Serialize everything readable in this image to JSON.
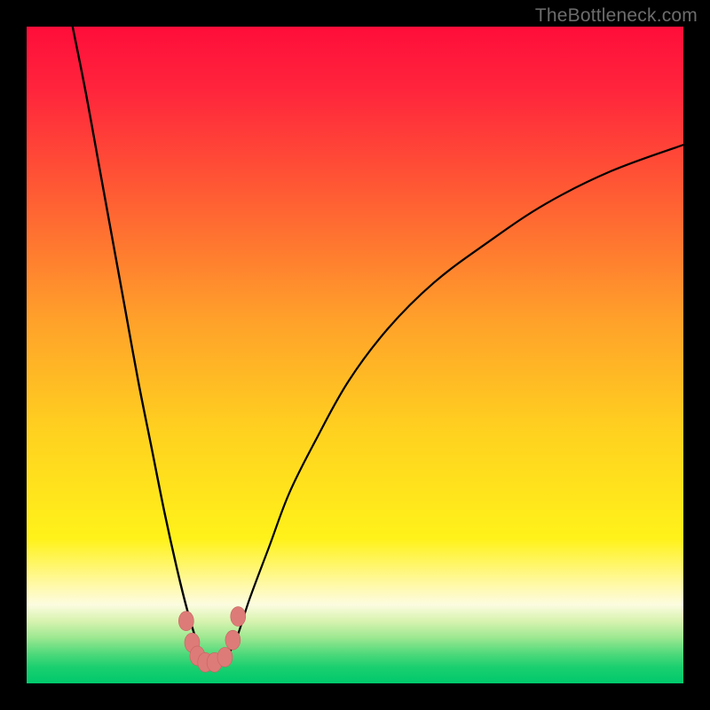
{
  "watermark": "TheBottleneck.com",
  "colors": {
    "frame_bg": "#000000",
    "gradient_stops": [
      {
        "pos": 0.0,
        "color": "#ff0d3a"
      },
      {
        "pos": 0.1,
        "color": "#ff263c"
      },
      {
        "pos": 0.25,
        "color": "#ff5a34"
      },
      {
        "pos": 0.45,
        "color": "#ffa22a"
      },
      {
        "pos": 0.62,
        "color": "#ffd21f"
      },
      {
        "pos": 0.78,
        "color": "#fff21a"
      },
      {
        "pos": 0.82,
        "color": "#fff66a"
      },
      {
        "pos": 0.85,
        "color": "#fff9a8"
      },
      {
        "pos": 0.88,
        "color": "#fcfce0"
      },
      {
        "pos": 0.905,
        "color": "#d8f3b0"
      },
      {
        "pos": 0.93,
        "color": "#9de891"
      },
      {
        "pos": 0.955,
        "color": "#4fd97b"
      },
      {
        "pos": 0.975,
        "color": "#1bcf6f"
      },
      {
        "pos": 1.0,
        "color": "#00c96c"
      }
    ],
    "curve_stroke": "#000000",
    "marker_fill": "#dd7b78",
    "marker_stroke": "#c76462"
  },
  "chart_data": {
    "type": "line",
    "title": "",
    "xlabel": "",
    "ylabel": "",
    "xlim": [
      0,
      100
    ],
    "ylim": [
      0,
      100
    ],
    "note": "Two curve segments descending into a V near x≈27 then rising asymptotically toward right. Values are estimated from pixels (0–100 normalized both axes, origin bottom-left).",
    "series": [
      {
        "name": "left-curve",
        "x": [
          7,
          9,
          11,
          13,
          15,
          17,
          19,
          21,
          23,
          24.5,
          26,
          27
        ],
        "y": [
          100,
          90,
          79,
          68,
          57,
          46,
          36,
          26,
          17,
          11,
          6,
          3
        ]
      },
      {
        "name": "right-curve",
        "x": [
          30,
          32,
          34,
          37,
          40,
          44,
          49,
          55,
          62,
          70,
          79,
          89,
          100
        ],
        "y": [
          3,
          7,
          13,
          21,
          29,
          37,
          46,
          54,
          61,
          67,
          73,
          78,
          82
        ]
      }
    ],
    "markers": {
      "name": "bottom-cluster",
      "points": [
        {
          "x": 24.3,
          "y": 9.5
        },
        {
          "x": 25.2,
          "y": 6.2
        },
        {
          "x": 26.0,
          "y": 4.2
        },
        {
          "x": 27.2,
          "y": 3.2
        },
        {
          "x": 28.6,
          "y": 3.2
        },
        {
          "x": 30.2,
          "y": 4.0
        },
        {
          "x": 31.4,
          "y": 6.6
        },
        {
          "x": 32.2,
          "y": 10.2
        }
      ]
    }
  }
}
